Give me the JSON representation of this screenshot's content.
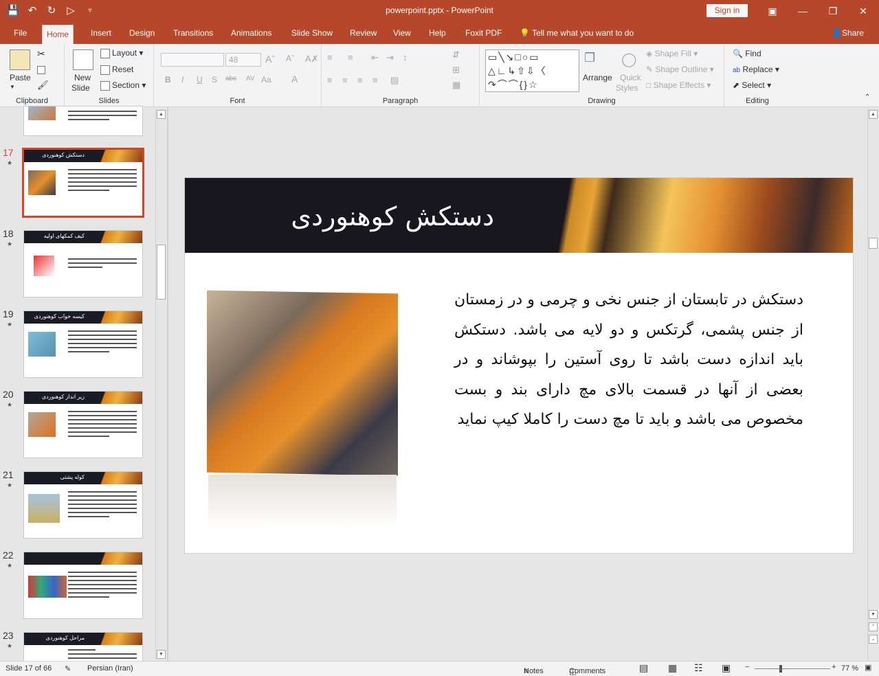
{
  "titlebar": {
    "title": "powerpoint.pptx  -  PowerPoint",
    "signin": "Sign in",
    "qat": {
      "save": "save-icon",
      "undo": "undo-icon",
      "redo": "redo-icon",
      "present": "present-icon",
      "customize": "customize-icon"
    }
  },
  "tabs": [
    "File",
    "Home",
    "Insert",
    "Design",
    "Transitions",
    "Animations",
    "Slide Show",
    "Review",
    "View",
    "Help",
    "Foxit PDF"
  ],
  "tellme": "Tell me what you want to do",
  "share": "Share",
  "ribbon": {
    "clipboard": {
      "label": "Clipboard",
      "paste": "Paste"
    },
    "slides": {
      "label": "Slides",
      "new_slide": "New",
      "new_slide2": "Slide",
      "layout": "Layout",
      "reset": "Reset",
      "section": "Section"
    },
    "font": {
      "label": "Font",
      "size": "48"
    },
    "paragraph": {
      "label": "Paragraph"
    },
    "drawing": {
      "label": "Drawing",
      "arrange": "Arrange",
      "quick": "Quick",
      "styles": "Styles",
      "shape_fill": "Shape Fill",
      "shape_outline": "Shape Outline",
      "shape_effects": "Shape Effects"
    },
    "editing": {
      "label": "Editing",
      "find": "Find",
      "replace": "Replace",
      "select": "Select"
    }
  },
  "thumbnails": [
    {
      "num": "17",
      "title": "دستکش کوهنوردی"
    },
    {
      "num": "18",
      "title": "کیف کمکهای اولیه"
    },
    {
      "num": "19",
      "title": "کیسه خواب کوهنوردی"
    },
    {
      "num": "20",
      "title": "زیر انداز کوهنوردی"
    },
    {
      "num": "21",
      "title": "کوله پشتی"
    },
    {
      "num": "22",
      "title": ""
    },
    {
      "num": "23",
      "title": "مراحل کوهنوردی"
    }
  ],
  "slide": {
    "title": "دستکش کوهنوردی",
    "body": "دستکش در تابستان از جنس نخی و چرمی و در زمستان از جنس پشمی، گرتکس و دو لایه می باشد. دستکش باید اندازه دست باشد تا روی آستین را بپوشاند و در بعضی از آنها در قسمت بالای مچ دارای بند و بست مخصوص می باشد و باید تا مچ دست را کاملا کیپ نماید"
  },
  "status": {
    "slide": "Slide 17 of 66",
    "language": "Persian (Iran)",
    "notes": "Notes",
    "comments": "Comments",
    "zoom": "77 %"
  }
}
